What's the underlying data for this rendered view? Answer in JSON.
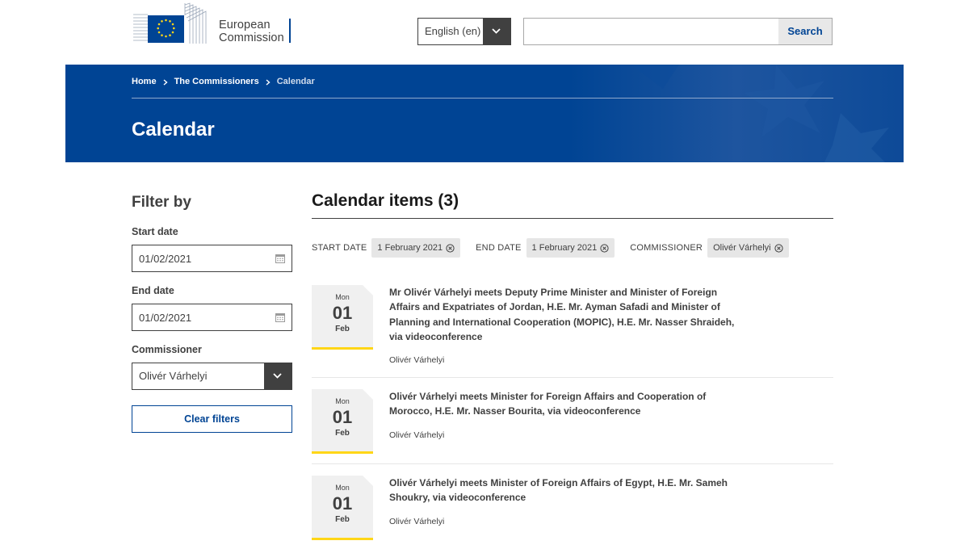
{
  "header": {
    "logo_text_line1": "European",
    "logo_text_line2": "Commission",
    "language": "English (en)",
    "search_placeholder": "",
    "search_button": "Search"
  },
  "banner": {
    "breadcrumb": [
      "Home",
      "The Commissioners",
      "Calendar"
    ],
    "title": "Calendar"
  },
  "sidebar": {
    "title": "Filter by",
    "start_label": "Start date",
    "start_value": "01/02/2021",
    "end_label": "End date",
    "end_value": "01/02/2021",
    "commissioner_label": "Commissioner",
    "commissioner_value": "Olivér Várhelyi",
    "clear_button": "Clear filters"
  },
  "main": {
    "title": "Calendar items (3)",
    "tags": [
      {
        "label": "START DATE",
        "value": "1 February 2021"
      },
      {
        "label": "END DATE",
        "value": "1 February 2021"
      },
      {
        "label": "COMMISSIONER",
        "value": "Olivér Várhelyi"
      }
    ],
    "events": [
      {
        "dow": "Mon",
        "day": "01",
        "month": "Feb",
        "title": "Mr Olivér Várhelyi meets Deputy Prime Minister and Minister of Foreign Affairs and Expatriates of Jordan, H.E. Mr. Ayman Safadi and Minister of Planning and International Cooperation (MOPIC), H.E. Mr. Nasser Shraideh, via videoconference",
        "author": "Olivér Várhelyi"
      },
      {
        "dow": "Mon",
        "day": "01",
        "month": "Feb",
        "title": "Olivér Várhelyi meets Minister for Foreign Affairs and Cooperation of Morocco, H.E. Mr. Nasser Bourita, via videoconference",
        "author": "Olivér Várhelyi"
      },
      {
        "dow": "Mon",
        "day": "01",
        "month": "Feb",
        "title": "Olivér Várhelyi meets Minister of Foreign Affairs of Egypt, H.E. Mr. Sameh Shoukry, via videoconference",
        "author": "Olivér Várhelyi"
      }
    ]
  },
  "colors": {
    "brand_blue": "#004494",
    "accent_yellow": "#ffd617",
    "text": "#404040"
  }
}
